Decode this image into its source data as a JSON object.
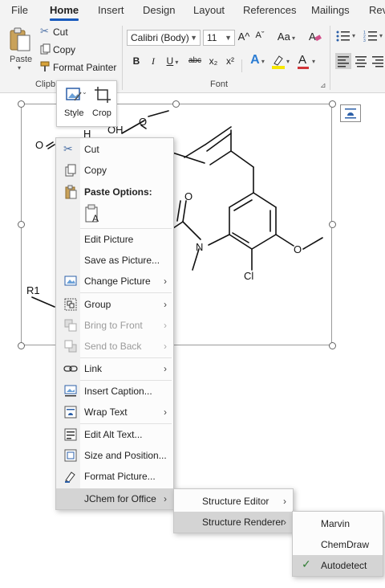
{
  "ribbon": {
    "tabs": [
      "File",
      "Home",
      "Insert",
      "Design",
      "Layout",
      "References",
      "Mailings",
      "Rev"
    ],
    "active_tab": "Home",
    "clipboard": {
      "paste_label": "Paste",
      "cut_label": "Cut",
      "copy_label": "Copy",
      "format_painter_label": "Format Painter",
      "group_label": "Clipb"
    },
    "font": {
      "font_name": "Calibri (Body)",
      "font_size": "11",
      "group_label": "Font",
      "change_case": "Aa",
      "bold": "B",
      "italic": "I",
      "underline": "U",
      "strikethrough": "abc",
      "subscript": "x₂",
      "superscript": "x²",
      "grow": "A^",
      "shrink": "Aˇ",
      "text_effects": "A",
      "font_color": "A",
      "highlight_color": "#f7e700",
      "font_color_value": "#d13438",
      "text_effects_color": "#2b7cd3"
    }
  },
  "mini_toolbar": {
    "style_label": "Style",
    "crop_label": "Crop"
  },
  "molecule": {
    "atoms": [
      "H",
      "OH",
      "O",
      "O",
      "O",
      "N",
      "O",
      "Cl",
      "R1"
    ]
  },
  "context_menu": {
    "items": [
      {
        "label": "Cut",
        "icon": "scissors-icon",
        "submenu": false,
        "disabled": false
      },
      {
        "label": "Copy",
        "icon": "copy-icon",
        "submenu": false,
        "disabled": false
      },
      {
        "label": "Paste Options:",
        "icon": "paste-icon",
        "submenu": false,
        "disabled": false,
        "header": true
      },
      {
        "label": "",
        "icon": "paste-keep-text-icon",
        "submenu": false,
        "disabled": false
      },
      {
        "label": "Edit Picture",
        "icon": "",
        "submenu": false,
        "disabled": false
      },
      {
        "label": "Save as Picture...",
        "icon": "",
        "submenu": false,
        "disabled": false
      },
      {
        "label": "Change Picture",
        "icon": "change-picture-icon",
        "submenu": true,
        "disabled": false
      },
      {
        "label": "Group",
        "icon": "group-icon",
        "submenu": true,
        "disabled": false
      },
      {
        "label": "Bring to Front",
        "icon": "bring-to-front-icon",
        "submenu": true,
        "disabled": true
      },
      {
        "label": "Send to Back",
        "icon": "send-to-back-icon",
        "submenu": true,
        "disabled": true
      },
      {
        "label": "Link",
        "icon": "link-icon",
        "submenu": true,
        "disabled": false
      },
      {
        "label": "Insert Caption...",
        "icon": "insert-caption-icon",
        "submenu": false,
        "disabled": false
      },
      {
        "label": "Wrap Text",
        "icon": "wrap-text-icon",
        "submenu": true,
        "disabled": false
      },
      {
        "label": "Edit Alt Text...",
        "icon": "alt-text-icon",
        "submenu": false,
        "disabled": false
      },
      {
        "label": "Size and Position...",
        "icon": "size-position-icon",
        "submenu": false,
        "disabled": false
      },
      {
        "label": "Format Picture...",
        "icon": "format-picture-icon",
        "submenu": false,
        "disabled": false
      },
      {
        "label": "JChem for Office",
        "icon": "",
        "submenu": true,
        "disabled": false,
        "highlighted": true
      }
    ]
  },
  "submenu_jchem": {
    "items": [
      {
        "label": "Structure Editor",
        "submenu": true
      },
      {
        "label": "Structure Renderer",
        "submenu": true,
        "highlighted": true
      }
    ]
  },
  "submenu_renderer": {
    "items": [
      {
        "label": "Marvin",
        "checked": false
      },
      {
        "label": "ChemDraw",
        "checked": false
      },
      {
        "label": "Autodetect",
        "checked": true,
        "highlighted": true
      }
    ]
  },
  "colors": {
    "accent": "#185abd",
    "menu_highlight": "#d4d4d4",
    "check": "#2f7d32"
  }
}
